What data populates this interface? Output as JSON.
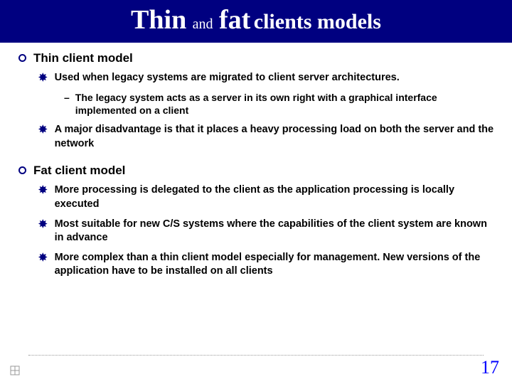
{
  "title": {
    "part1": "Thin",
    "part2": "and",
    "part3": "fat",
    "part4": "clients models"
  },
  "sections": [
    {
      "heading": "Thin client model",
      "bullets": [
        {
          "text": "Used when legacy systems are migrated to client server architectures.",
          "sub": [
            "The legacy system acts as a server in its own right with a graphical interface implemented on a client"
          ]
        },
        {
          "text": "A major disadvantage is that it places a heavy processing load on both the server and the network",
          "sub": []
        }
      ]
    },
    {
      "heading": "Fat client model",
      "bullets": [
        {
          "text": "More processing is delegated to the client as the application processing is locally executed",
          "sub": []
        },
        {
          "text": "Most suitable for new C/S systems where the capabilities of the client system are known in advance",
          "sub": []
        },
        {
          "text": "More complex than a thin client model especially for management. New versions of the application have to be installed on all clients",
          "sub": []
        }
      ]
    }
  ],
  "page_number": "17"
}
